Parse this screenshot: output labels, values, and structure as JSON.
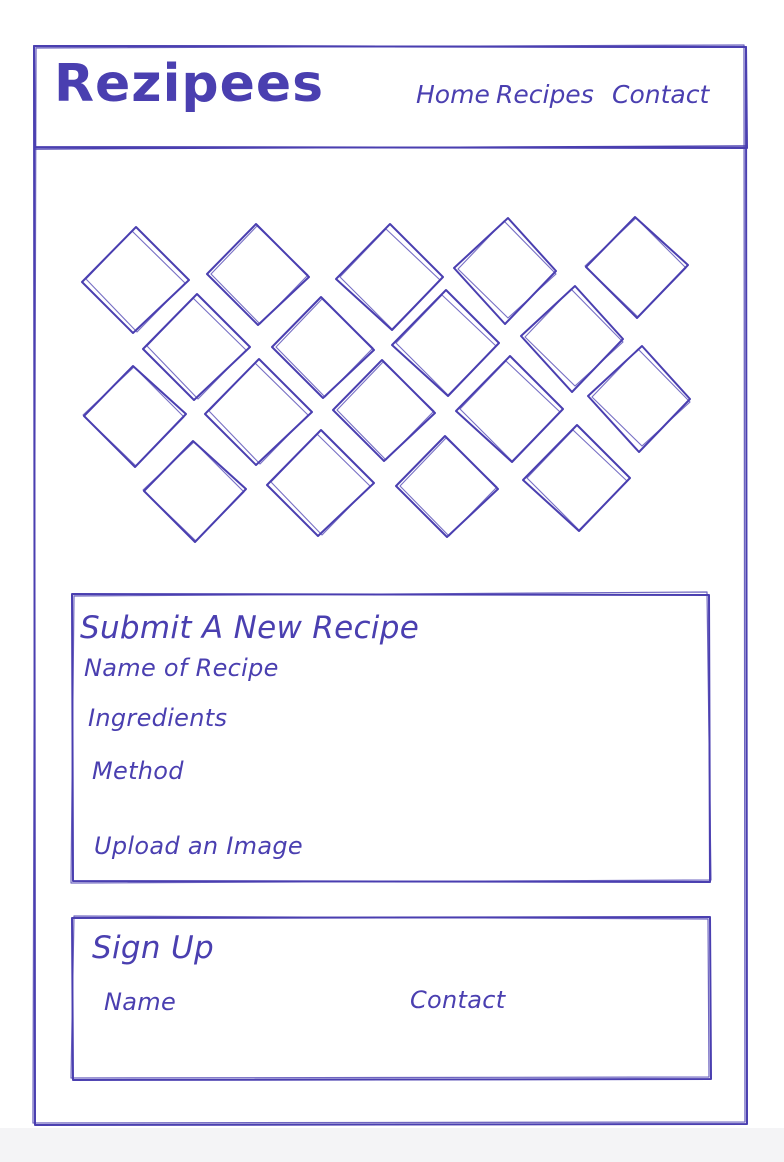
{
  "header": {
    "logo": "Rezipees",
    "nav": [
      {
        "label": "Home"
      },
      {
        "label": "Recipes"
      },
      {
        "label": "Contact"
      }
    ]
  },
  "gallery": {
    "icon": "image-placeholder-icon",
    "tile_count": 18
  },
  "recipe_form": {
    "title": "Submit A New Recipe",
    "fields": [
      {
        "label": "Name of Recipe"
      },
      {
        "label": "Ingredients"
      },
      {
        "label": "Method"
      },
      {
        "label": "Upload an Image"
      }
    ]
  },
  "signup": {
    "title": "Sign Up",
    "fields": [
      {
        "label": "Name"
      },
      {
        "label": "Contact"
      }
    ]
  },
  "colors": {
    "ink": "#4a3fb0",
    "background": "#ffffff"
  }
}
